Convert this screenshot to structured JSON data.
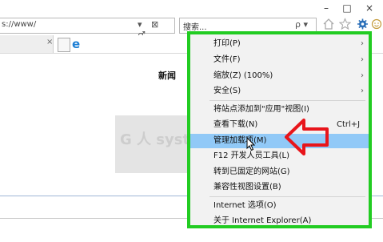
{
  "window": {
    "minimize": "–",
    "maximize": "□",
    "close": "×"
  },
  "address_bar": {
    "url": "s://www/",
    "icons": "▾ ⊠ ♂"
  },
  "search_bar": {
    "placeholder": "搜索...",
    "icon": "ρ ▾"
  },
  "toolbar_icons": [
    "home-icon",
    "star-icon",
    "gear-icon",
    "smile-icon"
  ],
  "tabs": {
    "close": "×"
  },
  "page": {
    "news_label": "新闻",
    "watermark": "G 人 system.c"
  },
  "menu": {
    "border_color": "#22cc22",
    "items": [
      {
        "label": "打印(P)",
        "arrow": "›"
      },
      {
        "label": "文件(F)",
        "arrow": "›"
      },
      {
        "label": "缩放(Z) (100%)",
        "arrow": "›"
      },
      {
        "label": "安全(S)",
        "arrow": "›"
      },
      {
        "label": "将站点添加到\"应用\"视图(I)"
      },
      {
        "label": "查看下载(N)",
        "shortcut": "Ctrl+J"
      },
      {
        "label": "管理加载项(M)",
        "highlighted": true
      },
      {
        "label": "F12 开发人员工具(L)"
      },
      {
        "label": "转到已固定的网站(G)"
      },
      {
        "label": "兼容性视图设置(B)"
      },
      {
        "label": "Internet 选项(O)"
      },
      {
        "label": "关于 Internet Explorer(A)"
      }
    ]
  },
  "annotation": {
    "arrow_color": "#e8151b"
  }
}
